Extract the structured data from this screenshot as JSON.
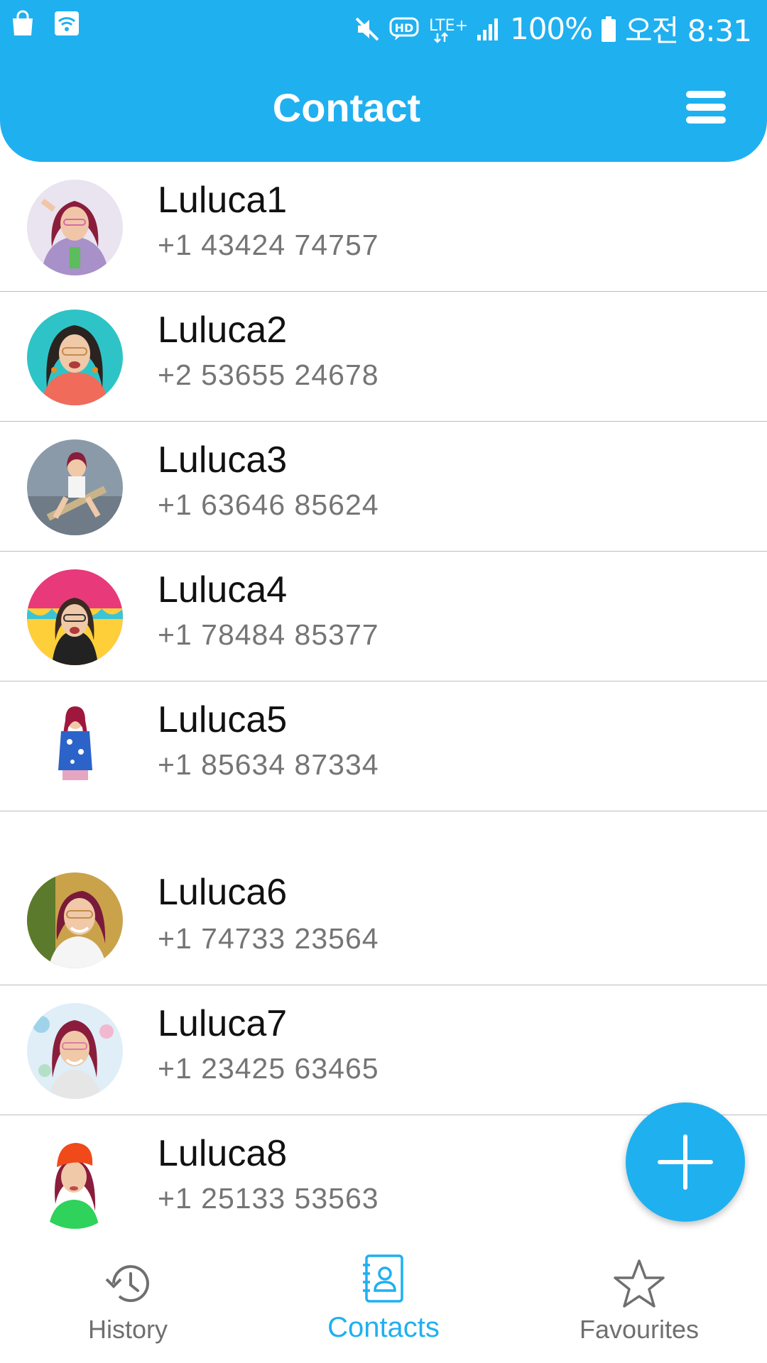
{
  "status_bar": {
    "battery": "100%",
    "time": "오전 8:31",
    "network": "LTE+",
    "hd_badge": "HD",
    "icons": [
      "shopping-bag-icon",
      "wifi-icon",
      "mute-icon",
      "hd-call-icon",
      "lte-icon",
      "signal-icon",
      "battery-icon"
    ]
  },
  "header": {
    "title": "Contact",
    "menu_icon": "hamburger-menu-icon",
    "background_color": "#1fb0f0"
  },
  "contacts": [
    {
      "name": "Luluca1",
      "phone": "+1 43424 74757"
    },
    {
      "name": "Luluca2",
      "phone": "+2 53655 24678"
    },
    {
      "name": "Luluca3",
      "phone": "+1 63646 85624"
    },
    {
      "name": "Luluca4",
      "phone": "+1 78484 85377"
    },
    {
      "name": "Luluca5",
      "phone": "+1 85634 87334"
    },
    {
      "name": "Luluca6",
      "phone": "+1 74733 23564"
    },
    {
      "name": "Luluca7",
      "phone": "+1 23425 63465"
    },
    {
      "name": "Luluca8",
      "phone": "+1 25133 53563"
    }
  ],
  "fab": {
    "icon": "plus-icon"
  },
  "bottom_nav": {
    "items": [
      {
        "label": "History",
        "icon": "history-icon",
        "active": false
      },
      {
        "label": "Contacts",
        "icon": "contacts-book-icon",
        "active": true
      },
      {
        "label": "Favourites",
        "icon": "star-icon",
        "active": false
      }
    ],
    "active_color": "#1fb0f0",
    "inactive_color": "#6f6f6f"
  }
}
